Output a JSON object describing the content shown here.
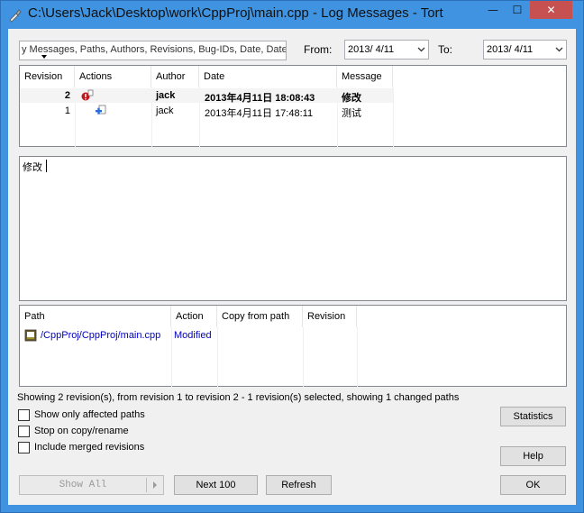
{
  "window": {
    "title": "C:\\Users\\Jack\\Desktop\\work\\CppProj\\main.cpp - Log Messages - Tort",
    "minimize_glyph": "—",
    "maximize_glyph": "☐",
    "close_glyph": "✕"
  },
  "filter": {
    "text": "y Messages, Paths, Authors, Revisions, Bug-IDs, Date, Date",
    "from_label": "From:",
    "from_value": "2013/  4/11",
    "to_label": "To:",
    "to_value": "2013/  4/11"
  },
  "revisions": {
    "columns": [
      "Revision",
      "Actions",
      "Author",
      "Date",
      "Message"
    ],
    "rows": [
      {
        "revision": "2",
        "author": "jack",
        "date": "2013年4月11日 18:08:43",
        "message": "修改"
      },
      {
        "revision": "1",
        "author": "jack",
        "date": "2013年4月11日 17:48:11",
        "message": "测试"
      }
    ]
  },
  "message_box": {
    "text": "修改"
  },
  "paths": {
    "columns": [
      "Path",
      "Action",
      "Copy from path",
      "Revision"
    ],
    "rows": [
      {
        "path": "/CppProj/CppProj/main.cpp",
        "action": "Modified"
      }
    ]
  },
  "status": "Showing 2 revision(s), from revision 1 to revision 2 - 1 revision(s) selected, showing 1 changed paths",
  "options": {
    "affected_paths": "Show only affected paths",
    "stop_copy": "Stop on copy/rename",
    "merged": "Include merged revisions"
  },
  "buttons": {
    "statistics": "Statistics",
    "help": "Help",
    "show_all": "Show All",
    "next_100": "Next 100",
    "refresh": "Refresh",
    "ok": "OK"
  },
  "colors": {
    "titlebar": "#3f93e0",
    "close": "#c75050",
    "link": "#0000c0"
  }
}
